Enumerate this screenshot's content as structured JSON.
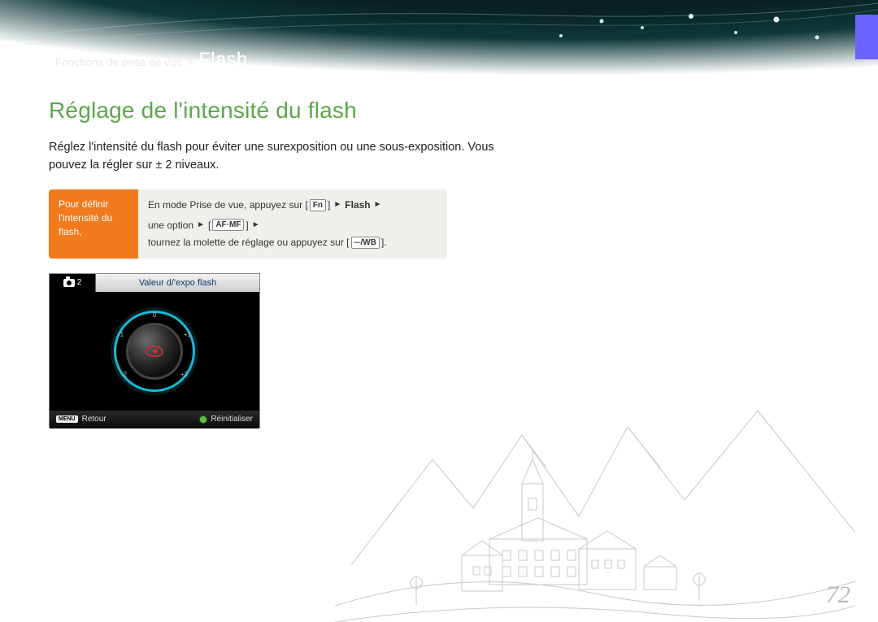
{
  "breadcrumb": {
    "section": "Fonctions de prise de vue",
    "sep": ">",
    "current": "Flash"
  },
  "heading": "Réglage de l'intensité du flash",
  "intro": "Réglez l'intensité du flash pour éviter une surexposition ou une sous-exposition. Vous pouvez la régler sur ± 2 niveaux.",
  "hint": {
    "left": "Pour définir l'intensité du flash,",
    "r1a": "En mode Prise de vue, appuyez sur [",
    "fn": "Fn",
    "r1b": "] ",
    "arrow": "►",
    "flash": "Flash",
    "r2a": "une option ",
    "r2b": " [",
    "afmf": "AF·MF",
    "r2c": "] ",
    "r2d": " tournez la molette de réglage ou appuyez sur [",
    "iconwb": "⏤/WB",
    "r2e": "]."
  },
  "lcd": {
    "mode_suffix": "2",
    "title": "Valeur d/'expo flash",
    "ticks": {
      "t0": "0",
      "m1": "-1",
      "p1": "+1",
      "m2": "-2",
      "p2": "+2"
    },
    "menu": "MENU",
    "back": "Retour",
    "reset": "Réinitialiser"
  },
  "page": "72"
}
